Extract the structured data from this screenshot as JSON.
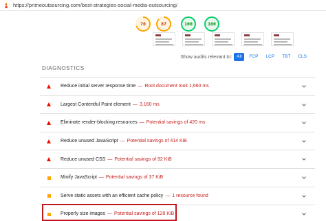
{
  "browser": {
    "url": "https://primeoutsourcing.com/best-strategies-social-media-outsourcing/",
    "icon": "lighthouse-icon"
  },
  "scores": [
    {
      "value": "70",
      "color": "#ffa400",
      "fraction": 0.7
    },
    {
      "value": "87",
      "color": "#ffa400",
      "fraction": 0.87
    },
    {
      "value": "100",
      "color": "#0cce6b",
      "fraction": 1.0
    },
    {
      "value": "100",
      "color": "#0cce6b",
      "fraction": 1.0
    }
  ],
  "filters": {
    "label": "Show audits relevant to:",
    "chips": [
      "All",
      "FCP",
      "LCP",
      "TBT",
      "CLS"
    ],
    "active": "All"
  },
  "diagnostics": {
    "heading": "DIAGNOSTICS",
    "audits": [
      {
        "severity": "fail",
        "title": "Reduce initial server response time",
        "sep": "—",
        "detail": "Root document took 1,660 ms"
      },
      {
        "severity": "fail",
        "title": "Largest Contentful Paint element",
        "sep": "—",
        "detail": "3,160 ms"
      },
      {
        "severity": "fail",
        "title": "Eliminate render-blocking resources",
        "sep": "—",
        "detail": "Potential savings of 420 ms"
      },
      {
        "severity": "fail",
        "title": "Reduce unused JavaScript",
        "sep": "—",
        "detail": "Potential savings of 414 KiB"
      },
      {
        "severity": "fail",
        "title": "Reduce unused CSS",
        "sep": "—",
        "detail": "Potential savings of 92 KiB"
      },
      {
        "severity": "average",
        "title": "Minify JavaScript",
        "sep": "—",
        "detail": "Potential savings of 37 KiB"
      },
      {
        "severity": "average",
        "title": "Serve static assets with an efficient cache policy",
        "sep": "—",
        "detail": "1 resource found"
      },
      {
        "severity": "average",
        "title": "Properly size images",
        "sep": "—",
        "detail": "Potential savings of 128 KiB"
      }
    ]
  },
  "colors": {
    "fail": "#eb0f00",
    "average": "#ffa400",
    "pass": "#0cce6b",
    "highlight": "#c0161c",
    "accent": "#1a73e8"
  }
}
